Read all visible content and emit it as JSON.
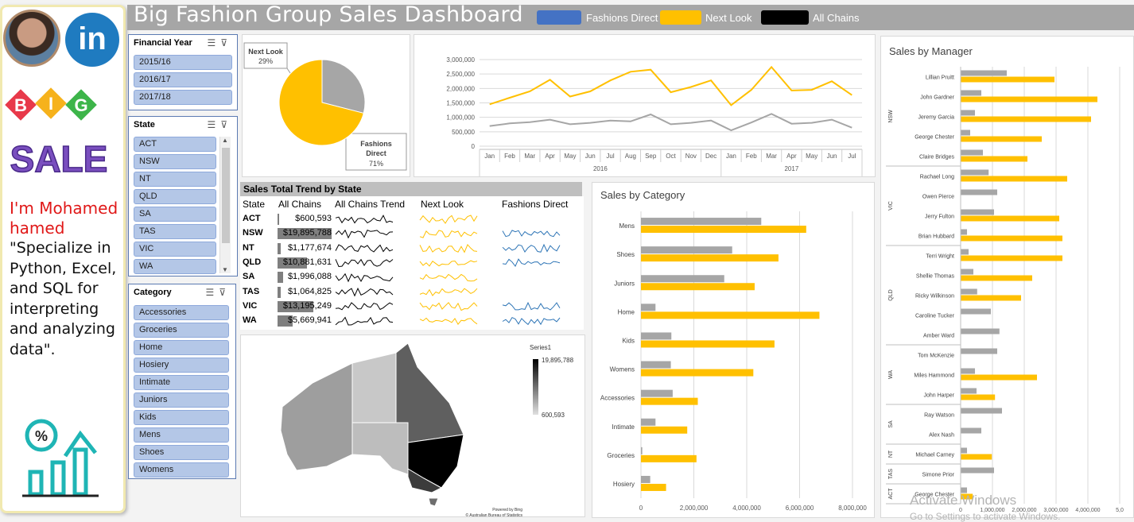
{
  "title": "Big Fashion Group Sales Dashboard",
  "legend": [
    {
      "label": "Fashions Direct",
      "color": "#4472c4"
    },
    {
      "label": "Next Look",
      "color": "#ffc000"
    },
    {
      "label": "All Chains",
      "color": "#000000"
    }
  ],
  "profile": {
    "linkedin_label": "in",
    "big_sale_text": "BIG SALE",
    "name_line": "I'm Mohamed hamed",
    "quote": "\"Specialize in Python, Excel, and SQL for interpreting and analyzing data\"."
  },
  "slicers": {
    "financial_year": {
      "title": "Financial Year",
      "items": [
        "2015/16",
        "2016/17",
        "2017/18"
      ]
    },
    "state": {
      "title": "State",
      "items": [
        "ACT",
        "NSW",
        "NT",
        "QLD",
        "SA",
        "TAS",
        "VIC",
        "WA"
      ]
    },
    "category": {
      "title": "Category",
      "items": [
        "Accessories",
        "Groceries",
        "Home",
        "Hosiery",
        "Intimate",
        "Juniors",
        "Kids",
        "Mens",
        "Shoes",
        "Womens"
      ]
    }
  },
  "icons": {
    "multiselect": "multi-select-icon",
    "clear_filter": "clear-filter-icon",
    "scroll_up": "▲",
    "scroll_down": "▼"
  },
  "colors": {
    "fashions_direct": "#4472c4",
    "next_look": "#ffc000",
    "all_chains": "#a6a6a6"
  },
  "trend_table": {
    "title": "Sales Total Trend by State",
    "headers": [
      "State",
      "All Chains",
      "All Chains Trend",
      "Next Look",
      "Fashions Direct"
    ],
    "rows": [
      {
        "state": "ACT",
        "all_chains": "$600,593",
        "value": 600593,
        "has_fd": false
      },
      {
        "state": "NSW",
        "all_chains": "$19,895,788",
        "value": 19895788,
        "has_fd": true
      },
      {
        "state": "NT",
        "all_chains": "$1,177,674",
        "value": 1177674,
        "has_fd": true
      },
      {
        "state": "QLD",
        "all_chains": "$10,881,631",
        "value": 10881631,
        "has_fd": true
      },
      {
        "state": "SA",
        "all_chains": "$1,996,088",
        "value": 1996088,
        "has_fd": false
      },
      {
        "state": "TAS",
        "all_chains": "$1,064,825",
        "value": 1064825,
        "has_fd": false
      },
      {
        "state": "VIC",
        "all_chains": "$13,195,249",
        "value": 13195249,
        "has_fd": true
      },
      {
        "state": "WA",
        "all_chains": "$5,669,941",
        "value": 5669941,
        "has_fd": true
      }
    ]
  },
  "map": {
    "legend_title": "Series1",
    "max_label": "19,895,788",
    "min_label": "600,593",
    "credit1": "Powered by Bing",
    "credit2": "© Australian Bureau of Statistics"
  },
  "chart_data": [
    {
      "type": "pie",
      "categories": [
        "Next Look",
        "Fashions Direct"
      ],
      "values": [
        29,
        71
      ],
      "labels": [
        "29%",
        "71%"
      ],
      "colors": [
        "#a6a6a6",
        "#ffc000"
      ]
    },
    {
      "type": "line",
      "categories": [
        "Jan",
        "Feb",
        "Mar",
        "Apr",
        "May",
        "Jun",
        "Jul",
        "Aug",
        "Sep",
        "Oct",
        "Nov",
        "Dec",
        "Jan",
        "Feb",
        "Mar",
        "Apr",
        "May",
        "Jun",
        "Jul"
      ],
      "year_labels": [
        "2016",
        "2017"
      ],
      "ylim": [
        0,
        3000000
      ],
      "yticks": [
        "0",
        "500,000",
        "1,000,000",
        "1,500,000",
        "2,000,000",
        "2,500,000",
        "3,000,000"
      ],
      "grid": true,
      "series": [
        {
          "color": "#ffc000",
          "values": [
            1450000,
            1680000,
            1900000,
            2300000,
            1720000,
            1900000,
            2280000,
            2580000,
            2650000,
            1870000,
            2050000,
            2280000,
            1420000,
            1950000,
            2740000,
            1930000,
            1950000,
            2250000,
            1770000
          ]
        },
        {
          "color": "#a6a6a6",
          "values": [
            700000,
            790000,
            830000,
            920000,
            760000,
            810000,
            890000,
            860000,
            1100000,
            760000,
            810000,
            890000,
            550000,
            820000,
            1120000,
            780000,
            810000,
            920000,
            640000
          ]
        }
      ]
    },
    {
      "type": "bar",
      "title": "Sales by Category",
      "categories": [
        "Mens",
        "Shoes",
        "Juniors",
        "Home",
        "Kids",
        "Womens",
        "Accessories",
        "Intimate",
        "Groceries",
        "Hosiery"
      ],
      "xlim": [
        0,
        8000000
      ],
      "xticks": [
        "0",
        "2,000,000",
        "4,000,000",
        "6,000,000",
        "8,000,000"
      ],
      "grid": true,
      "series": [
        {
          "color": "#a6a6a6",
          "values": [
            4550000,
            3450000,
            3150000,
            550000,
            1150000,
            1130000,
            1200000,
            550000,
            50000,
            350000
          ]
        },
        {
          "color": "#ffc000",
          "values": [
            6250000,
            5200000,
            4300000,
            6750000,
            5050000,
            4250000,
            2150000,
            1750000,
            2100000,
            950000
          ]
        }
      ]
    },
    {
      "type": "bar",
      "title": "Sales by Manager",
      "groups": [
        {
          "label": "NSW",
          "managers": [
            "Lillian Pruitt",
            "John Gardner",
            "Jeremy Garcia",
            "George Chester",
            "Claire Bridges"
          ]
        },
        {
          "label": "VIC",
          "managers": [
            "Rachael Long",
            "Owen Pierce",
            "Jerry Fulton",
            "Brian Hubbard"
          ]
        },
        {
          "label": "QLD",
          "managers": [
            "Terri Wright",
            "Shellie Thomas",
            "Ricky Wilkinson",
            "Caroline Tucker",
            "Amber Ward"
          ]
        },
        {
          "label": "WA",
          "managers": [
            "Tom McKenzie",
            "Miles Hammond",
            "John Harper"
          ]
        },
        {
          "label": "SA",
          "managers": [
            "Ray Watson",
            "Alex Nash"
          ]
        },
        {
          "label": "NT",
          "managers": [
            "Michael Carney"
          ]
        },
        {
          "label": "TAS",
          "managers": [
            "Simone Prior"
          ]
        },
        {
          "label": "ACT",
          "managers": [
            "George Chester"
          ]
        }
      ],
      "xlim": [
        0,
        5000000
      ],
      "xticks": [
        "0",
        "1,000,000",
        "2,000,000",
        "3,000,000",
        "4,000,000",
        "5,0"
      ],
      "grid": true,
      "series": [
        {
          "color": "#a6a6a6",
          "values": [
            1450000,
            650000,
            450000,
            300000,
            700000,
            880000,
            1150000,
            1050000,
            200000,
            250000,
            400000,
            520000,
            950000,
            1220000,
            1150000,
            450000,
            500000,
            1300000,
            650000,
            200000,
            1050000,
            200000
          ]
        },
        {
          "color": "#ffc000",
          "values": [
            2950000,
            4300000,
            4100000,
            2550000,
            2100000,
            3350000,
            0,
            3100000,
            3200000,
            3200000,
            2250000,
            1900000,
            0,
            0,
            0,
            2400000,
            1080000,
            0,
            0,
            980000,
            0,
            380000
          ]
        }
      ]
    }
  ],
  "watermark": {
    "line1": "Activate Windows",
    "line2": "Go to Settings to activate Windows."
  }
}
